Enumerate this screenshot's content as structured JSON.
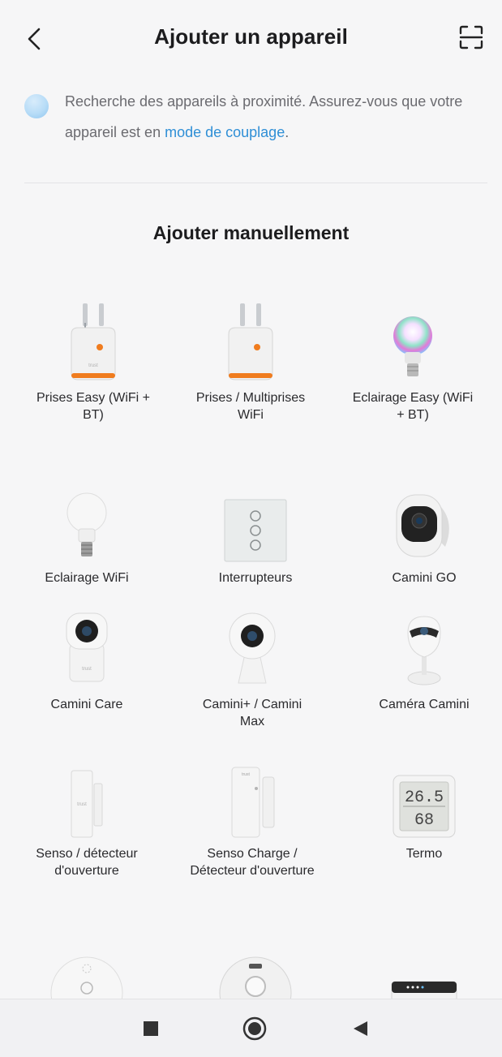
{
  "header": {
    "title": "Ajouter un appareil",
    "back_icon": "chevron-left-icon",
    "scan_icon": "scan-frame-icon"
  },
  "search": {
    "text": "Recherche des appareils à proximité. Assurez-vous que votre appareil est en ",
    "link": "mode de couplage",
    "suffix": ".",
    "accent_color": "#2f8fd6"
  },
  "manual": {
    "title": "Ajouter manuellement"
  },
  "devices": [
    {
      "label": "Prises Easy (WiFi + BT)",
      "icon": "smart-plug-icon"
    },
    {
      "label": "Prises / Multiprises WiFi",
      "icon": "smart-plug-icon"
    },
    {
      "label": "Eclairage Easy (WiFi + BT)",
      "icon": "rgb-bulb-icon"
    },
    {
      "label": "Eclairage WiFi",
      "icon": "bulb-icon"
    },
    {
      "label": "Interrupteurs",
      "icon": "wall-switch-icon"
    },
    {
      "label": "Camini GO",
      "icon": "outdoor-camera-icon"
    },
    {
      "label": "Camini Care",
      "icon": "baby-camera-icon"
    },
    {
      "label": "Camini+ / Camini Max",
      "icon": "dome-camera-icon"
    },
    {
      "label": "Caméra Camini",
      "icon": "ball-camera-icon"
    },
    {
      "label": "Senso / détecteur d'ouverture",
      "icon": "door-sensor-icon"
    },
    {
      "label": "Senso Charge / Détecteur d'ouverture",
      "icon": "door-sensor-charge-icon"
    },
    {
      "label": "Termo",
      "icon": "thermometer-display-icon"
    },
    {
      "label": "",
      "icon": "smoke-detector-icon"
    },
    {
      "label": "",
      "icon": "smoke-detector-icon"
    },
    {
      "label": "",
      "icon": "hub-gateway-icon"
    }
  ],
  "termo_display": {
    "temp": "26.5",
    "humidity": "68"
  },
  "navbar": {
    "recent_icon": "square-icon",
    "home_icon": "circle-home-icon",
    "back_icon": "triangle-back-icon"
  }
}
